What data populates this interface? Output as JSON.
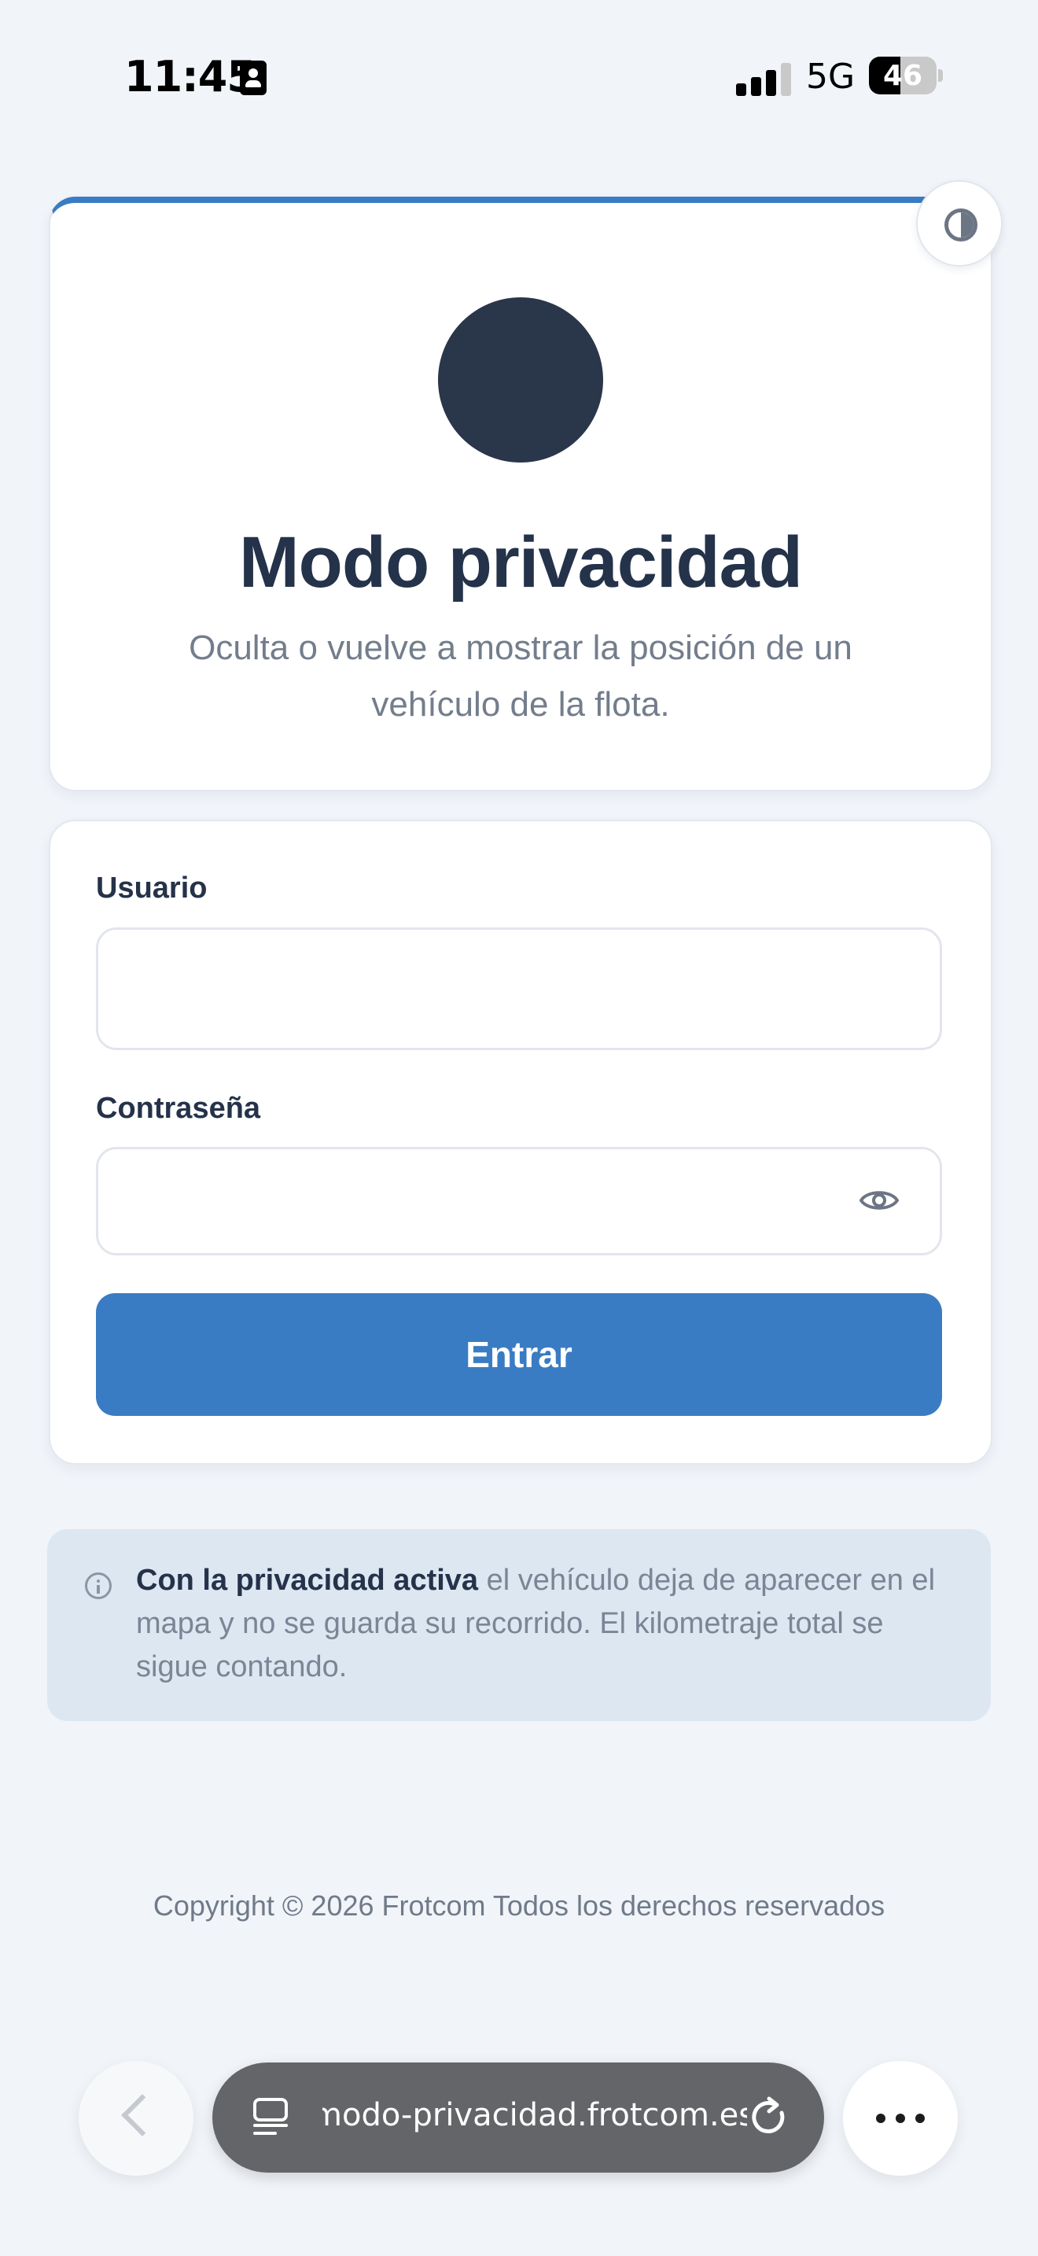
{
  "status_bar": {
    "time": "11:45",
    "network": "5G",
    "battery": "46",
    "battery_level": 0.46
  },
  "header": {
    "title": "Modo privacidad",
    "subtitle": "Oculta o vuelve a mostrar la posición de un vehículo de la flota."
  },
  "form": {
    "user_label": "Usuario",
    "user_value": "",
    "password_label": "Contraseña",
    "password_value": "",
    "submit_label": "Entrar"
  },
  "info": {
    "bold": "Con la privacidad activa",
    "text": " el vehículo deja de aparecer en el mapa y no se guarda su recorrido. El kilometraje total se sigue contando."
  },
  "footer": {
    "copyright": "Copyright © 2026 Frotcom Todos los derechos reservados"
  },
  "browser": {
    "url": "modo-privacidad.frotcom.es"
  },
  "colors": {
    "accent": "#3a7cc3",
    "background": "#f1f4f9",
    "title": "#24324a",
    "info_bg": "#dce7f2"
  }
}
